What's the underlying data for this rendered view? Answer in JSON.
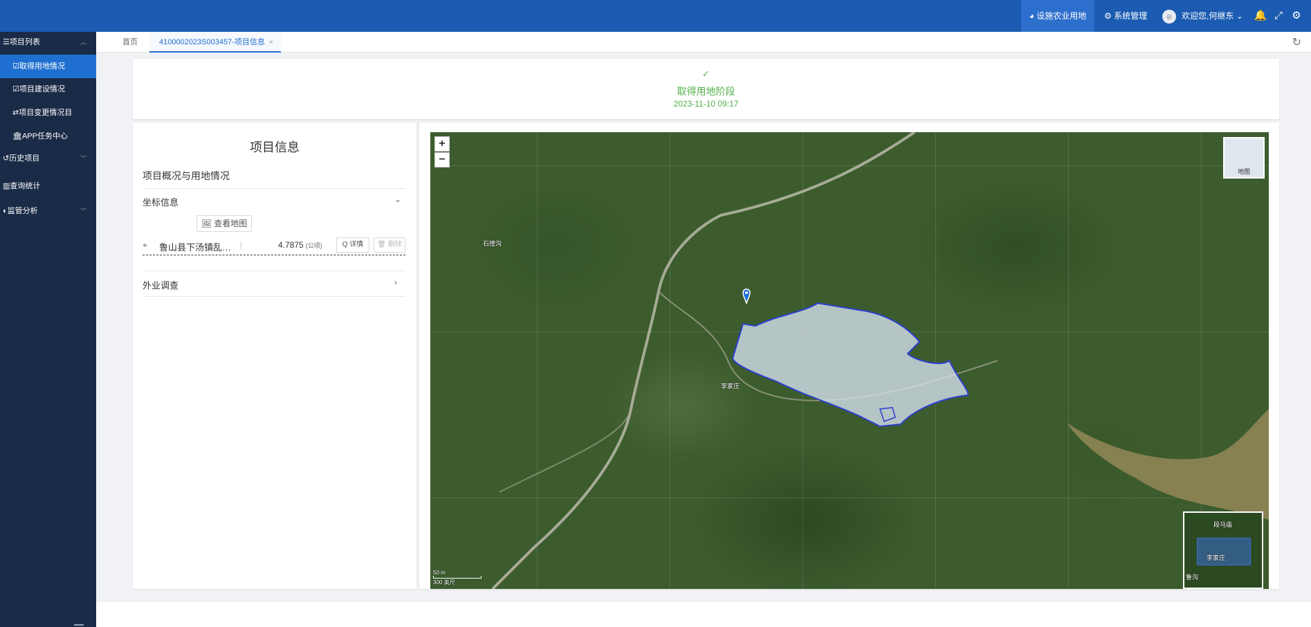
{
  "topbar": {
    "active_module": "设施农业用地",
    "system_mgmt": "系统管理",
    "welcome": "欢迎您,何继东",
    "avatar_text": "◎",
    "brand_color": "#1b5bb1"
  },
  "sidebar": {
    "group_projects": "☰项目列表",
    "items": [
      {
        "label": "☑取得用地情况"
      },
      {
        "label": "☑项目建设情况"
      },
      {
        "label": "⇄项目变更情况目"
      },
      {
        "label": "🏛APP任务中心"
      }
    ],
    "group_history": "↺历史项目",
    "group_query": "▥查询统计",
    "group_monitor": "◐监管分析"
  },
  "tabs": {
    "home": "首页",
    "active": "4100002023S003457-项目信息",
    "close": "×"
  },
  "stage": {
    "check": "✓",
    "name": "取得用地阶段",
    "time": "2023-11-10 09:17"
  },
  "panel": {
    "title": "项目信息",
    "subtitle": "项目概况与用地情况",
    "coord_section": "坐标信息",
    "view_map": "🖼 查看地图",
    "coord_name": "鲁山县下汤镇乱石沟村",
    "coord_area": "4.7875",
    "coord_unit": "(公顷)",
    "detail_btn": "Q 详情",
    "delete_btn": "🗑 删除",
    "survey_section": "外业调查"
  },
  "map": {
    "zoom_in": "+",
    "zoom_out": "−",
    "layer_switch": "地图",
    "places": [
      "石撞沟",
      "李家庄"
    ],
    "overview_places": [
      "段马庙",
      "李家庄",
      "鲁沟"
    ],
    "scale_label": "50 m",
    "scale_sub": "300 英尺",
    "polygon_color": "#2b3fd0"
  }
}
